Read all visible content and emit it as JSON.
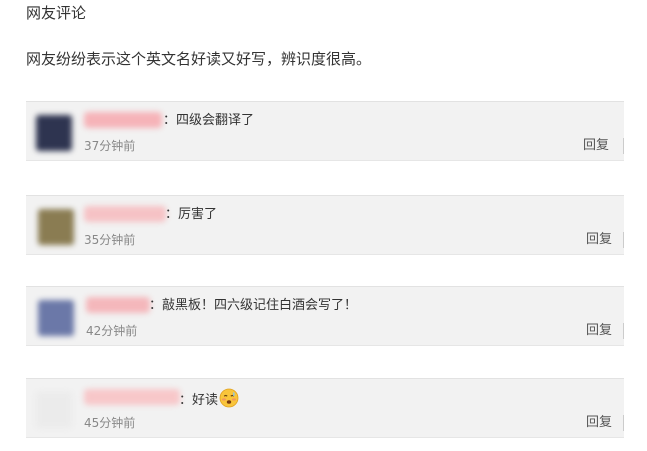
{
  "header": {
    "section_title": "网友评论",
    "intro": "网友纷纷表示这个英文名好读又好写，辨识度很高。"
  },
  "comments": [
    {
      "text": "：四级会翻译了",
      "time": "37分钟前",
      "reply_label": "回复",
      "avatar_color": "#2e3450",
      "username_color": "#f6b3b8"
    },
    {
      "text": "：厉害了",
      "time": "35分钟前",
      "reply_label": "回复",
      "avatar_color": "#8a7c52",
      "username_color": "#f6c2c5"
    },
    {
      "text": "：敲黑板！四六级记住白酒会写了！",
      "time": "42分钟前",
      "reply_label": "回复",
      "avatar_color": "#6b78a8",
      "username_color": "#f4b7bb"
    },
    {
      "text": "：好读",
      "time": "45分钟前",
      "reply_label": "回复",
      "avatar_color": "#ebebeb",
      "username_color": "#f7c7c9",
      "emoji": "embarrassed-face-icon"
    }
  ]
}
